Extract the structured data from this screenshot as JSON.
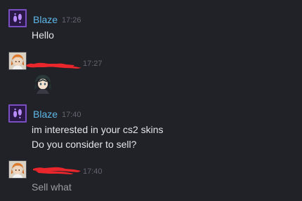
{
  "messages": [
    {
      "sender": "Blaze",
      "time": "17:26",
      "lines": [
        "Hello"
      ],
      "avatar_icon": "purple-footprints-avatar"
    },
    {
      "sender": "",
      "sender_redacted": true,
      "time": "17:27",
      "lines": [],
      "sticker_icon": "anime-character-sticker",
      "avatar_icon": "anime-character-avatar"
    },
    {
      "sender": "Blaze",
      "time": "17:40",
      "lines": [
        "im interested in your cs2 skins",
        "Do you consider to sell?"
      ],
      "avatar_icon": "purple-footprints-avatar"
    },
    {
      "sender": "",
      "sender_redacted": true,
      "time": "17:40",
      "lines": [
        "Sell what"
      ],
      "avatar_icon": "anime-character-avatar"
    }
  ],
  "colors": {
    "background": "#202227",
    "sender_name": "#5fb8ea",
    "timestamp": "#62666e",
    "message_text": "#e3e5e9",
    "redaction": "#e8262c"
  }
}
